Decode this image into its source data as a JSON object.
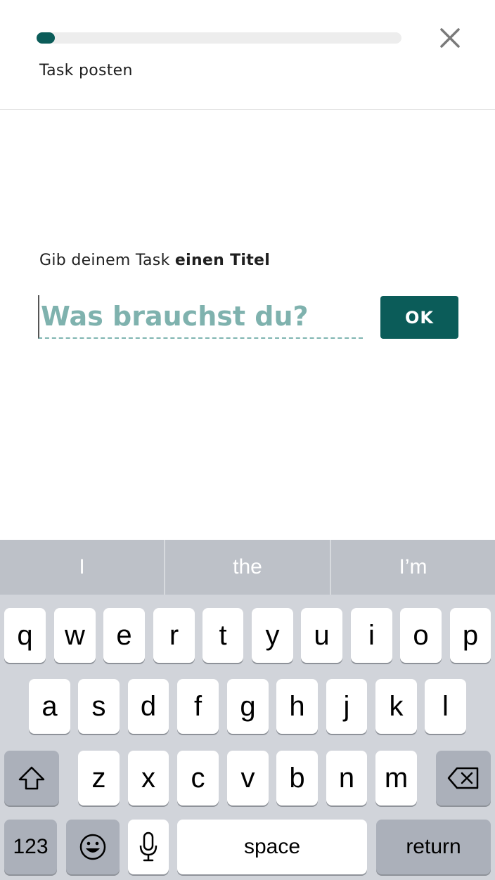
{
  "header": {
    "progress_percent": 5,
    "title": "Task posten"
  },
  "prompt": {
    "normal": "Gib deinem Task ",
    "bold": "einen Titel"
  },
  "title_input": {
    "value": "",
    "placeholder": "Was brauchst du?"
  },
  "ok_button": "OK",
  "keyboard": {
    "suggestions": [
      "I",
      "the",
      "I’m"
    ],
    "row1": [
      "q",
      "w",
      "e",
      "r",
      "t",
      "y",
      "u",
      "i",
      "o",
      "p"
    ],
    "row2": [
      "a",
      "s",
      "d",
      "f",
      "g",
      "h",
      "j",
      "k",
      "l"
    ],
    "row3": [
      "z",
      "x",
      "c",
      "v",
      "b",
      "n",
      "m"
    ],
    "numbers_label": "123",
    "space_label": "space",
    "return_label": "return"
  },
  "colors": {
    "accent": "#0b5c59",
    "placeholder": "#7fb2ae",
    "keyboard_bg": "#d1d4da"
  }
}
